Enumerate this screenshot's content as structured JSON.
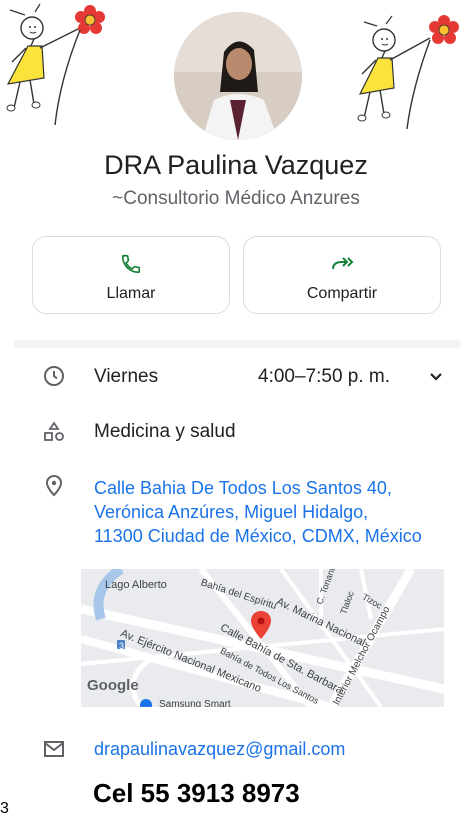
{
  "profile": {
    "name": "DRA Paulina Vazquez",
    "subtitle": "~Consultorio Médico Anzures"
  },
  "actions": {
    "call_label": "Llamar",
    "share_label": "Compartir"
  },
  "hours": {
    "day": "Viernes",
    "time": "4:00–7:50 p. m."
  },
  "category": "Medicina y salud",
  "address": "Calle Bahia De Todos Los Santos 40,\nVerónica Anzúres, Miguel Hidalgo,\n11300 Ciudad de México, CDMX, México",
  "map": {
    "labels": {
      "lago_alberto": "Lago Alberto",
      "bahia_espiritu": "Bahía del Espíritu",
      "av_marina": "Av. Marina Nacional",
      "calle_bahia": "Calle Bahía de Sta. Barbara",
      "bahia_todos": "Bahía de Todos Los Santos",
      "ejercito": "Av. Ejército Nacional Mexicano",
      "interior": "Interior Melchor Ocampo",
      "tonantzin": "C. Tonantzin",
      "tlaloc": "Tlaloc",
      "tizoc": "Tizoc",
      "samsung": "Samsung Smart",
      "google": "Google",
      "road_3": "3"
    },
    "accent_pin": "#ea4335"
  },
  "email": "drapaulinavazquez@gmail.com",
  "phone": "Cel 55 3913 8973",
  "stray_char": "3",
  "colors": {
    "link": "#1a73e8",
    "action_icon": "#188038",
    "flower": "#e53935",
    "dress": "#fbe33b"
  },
  "icons": [
    "phone-icon",
    "share-arrow-icon",
    "clock-icon",
    "chevron-down-icon",
    "shapes-icon",
    "location-pin-icon",
    "email-icon"
  ]
}
